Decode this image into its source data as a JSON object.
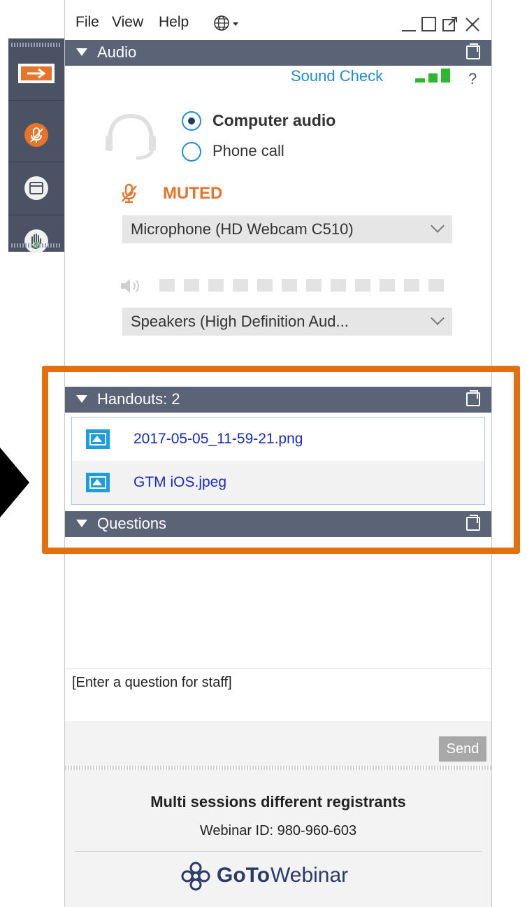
{
  "menu": {
    "file": "File",
    "view": "View",
    "help": "Help",
    "globe_icon": "globe-icon"
  },
  "audio": {
    "title": "Audio",
    "sound_check": "Sound Check",
    "help_mark": "?",
    "options": [
      "Computer audio",
      "Phone call"
    ],
    "selected_option": "Computer audio",
    "muted_label": "MUTED",
    "microphone": "Microphone (HD Webcam C510)",
    "speakers": "Speakers (High Definition Aud...",
    "speaker_level": 0
  },
  "handouts": {
    "title": "Handouts: 2",
    "files": [
      "2017-05-05_11-59-21.png",
      "GTM iOS.jpeg"
    ]
  },
  "questions": {
    "title": "Questions",
    "input_placeholder": "[Enter a question for staff]",
    "send_label": "Send"
  },
  "footer": {
    "session_title": "Multi sessions different registrants",
    "webinar_id": "Webinar ID: 980-960-603",
    "brand_goto": "GoTo",
    "brand_webinar": "Webinar"
  },
  "colors": {
    "section_bar": "#5b6377",
    "accent_blue": "#1f8dd6",
    "muted_orange": "#e8732a",
    "highlight_orange": "#e3700f",
    "file_link": "#1a2bbf",
    "sound_check_green": "#2eb82e"
  }
}
